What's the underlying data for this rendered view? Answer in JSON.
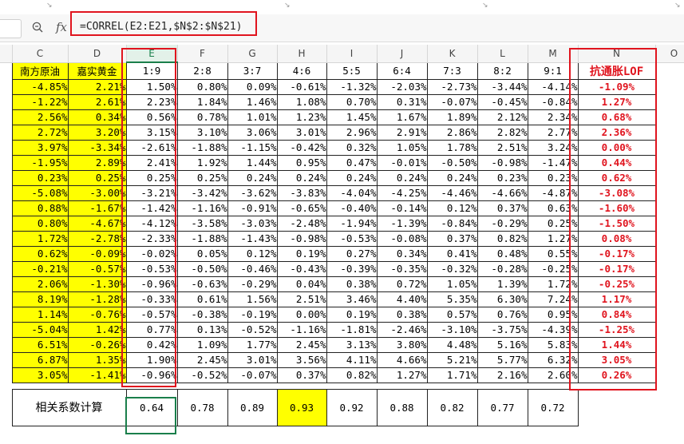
{
  "formula_bar": {
    "formula": "=CORREL(E2:E21,$N$2:$N$21)",
    "zoom_icon": "magnifier-icon",
    "fx_label": "fx"
  },
  "columns": [
    "C",
    "D",
    "E",
    "F",
    "G",
    "H",
    "I",
    "J",
    "K",
    "L",
    "M",
    "N",
    "O"
  ],
  "headers": [
    "南方原油",
    "嘉实黄金",
    "1:9",
    "2:8",
    "3:7",
    "4:6",
    "5:5",
    "6:4",
    "7:3",
    "8:2",
    "9:1",
    "抗通胀LOF"
  ],
  "rows": [
    [
      "-4.85%",
      "2.21%",
      "1.50%",
      "0.80%",
      "0.09%",
      "-0.61%",
      "-1.32%",
      "-2.03%",
      "-2.73%",
      "-3.44%",
      "-4.14%",
      "-1.09%"
    ],
    [
      "-1.22%",
      "2.61%",
      "2.23%",
      "1.84%",
      "1.46%",
      "1.08%",
      "0.70%",
      "0.31%",
      "-0.07%",
      "-0.45%",
      "-0.84%",
      "1.27%"
    ],
    [
      "2.56%",
      "0.34%",
      "0.56%",
      "0.78%",
      "1.01%",
      "1.23%",
      "1.45%",
      "1.67%",
      "1.89%",
      "2.12%",
      "2.34%",
      "0.68%"
    ],
    [
      "2.72%",
      "3.20%",
      "3.15%",
      "3.10%",
      "3.06%",
      "3.01%",
      "2.96%",
      "2.91%",
      "2.86%",
      "2.82%",
      "2.77%",
      "2.36%"
    ],
    [
      "3.97%",
      "-3.34%",
      "-2.61%",
      "-1.88%",
      "-1.15%",
      "-0.42%",
      "0.32%",
      "1.05%",
      "1.78%",
      "2.51%",
      "3.24%",
      "0.00%"
    ],
    [
      "-1.95%",
      "2.89%",
      "2.41%",
      "1.92%",
      "1.44%",
      "0.95%",
      "0.47%",
      "-0.01%",
      "-0.50%",
      "-0.98%",
      "-1.47%",
      "0.44%"
    ],
    [
      "0.23%",
      "0.25%",
      "0.25%",
      "0.25%",
      "0.24%",
      "0.24%",
      "0.24%",
      "0.24%",
      "0.24%",
      "0.23%",
      "0.23%",
      "0.62%"
    ],
    [
      "-5.08%",
      "-3.00%",
      "-3.21%",
      "-3.42%",
      "-3.62%",
      "-3.83%",
      "-4.04%",
      "-4.25%",
      "-4.46%",
      "-4.66%",
      "-4.87%",
      "-3.08%"
    ],
    [
      "0.88%",
      "-1.67%",
      "-1.42%",
      "-1.16%",
      "-0.91%",
      "-0.65%",
      "-0.40%",
      "-0.14%",
      "0.12%",
      "0.37%",
      "0.63%",
      "-1.60%"
    ],
    [
      "0.80%",
      "-4.67%",
      "-4.12%",
      "-3.58%",
      "-3.03%",
      "-2.48%",
      "-1.94%",
      "-1.39%",
      "-0.84%",
      "-0.29%",
      "0.25%",
      "-1.50%"
    ],
    [
      "1.72%",
      "-2.78%",
      "-2.33%",
      "-1.88%",
      "-1.43%",
      "-0.98%",
      "-0.53%",
      "-0.08%",
      "0.37%",
      "0.82%",
      "1.27%",
      "0.08%"
    ],
    [
      "0.62%",
      "-0.09%",
      "-0.02%",
      "0.05%",
      "0.12%",
      "0.19%",
      "0.27%",
      "0.34%",
      "0.41%",
      "0.48%",
      "0.55%",
      "-0.17%"
    ],
    [
      "-0.21%",
      "-0.57%",
      "-0.53%",
      "-0.50%",
      "-0.46%",
      "-0.43%",
      "-0.39%",
      "-0.35%",
      "-0.32%",
      "-0.28%",
      "-0.25%",
      "-0.17%"
    ],
    [
      "2.06%",
      "-1.30%",
      "-0.96%",
      "-0.63%",
      "-0.29%",
      "0.04%",
      "0.38%",
      "0.72%",
      "1.05%",
      "1.39%",
      "1.72%",
      "-0.25%"
    ],
    [
      "8.19%",
      "-1.28%",
      "-0.33%",
      "0.61%",
      "1.56%",
      "2.51%",
      "3.46%",
      "4.40%",
      "5.35%",
      "6.30%",
      "7.24%",
      "1.17%"
    ],
    [
      "1.14%",
      "-0.76%",
      "-0.57%",
      "-0.38%",
      "-0.19%",
      "0.00%",
      "0.19%",
      "0.38%",
      "0.57%",
      "0.76%",
      "0.95%",
      "0.84%"
    ],
    [
      "-5.04%",
      "1.42%",
      "0.77%",
      "0.13%",
      "-0.52%",
      "-1.16%",
      "-1.81%",
      "-2.46%",
      "-3.10%",
      "-3.75%",
      "-4.39%",
      "-1.25%"
    ],
    [
      "6.51%",
      "-0.26%",
      "0.42%",
      "1.09%",
      "1.77%",
      "2.45%",
      "3.13%",
      "3.80%",
      "4.48%",
      "5.16%",
      "5.83%",
      "1.44%"
    ],
    [
      "6.87%",
      "1.35%",
      "1.90%",
      "2.45%",
      "3.01%",
      "3.56%",
      "4.11%",
      "4.66%",
      "5.21%",
      "5.77%",
      "6.32%",
      "3.05%"
    ],
    [
      "3.05%",
      "-1.41%",
      "-0.96%",
      "-0.52%",
      "-0.07%",
      "0.37%",
      "0.82%",
      "1.27%",
      "1.71%",
      "2.16%",
      "2.60%",
      "0.26%"
    ]
  ],
  "correlation": {
    "label": "相关系数计算",
    "values": [
      "0.64",
      "0.78",
      "0.89",
      "0.93",
      "0.92",
      "0.88",
      "0.82",
      "0.77",
      "0.72"
    ]
  },
  "colors": {
    "highlight": "#ffff00",
    "annotation_red": "#e0141e",
    "selection_green": "#1a7f4b"
  }
}
